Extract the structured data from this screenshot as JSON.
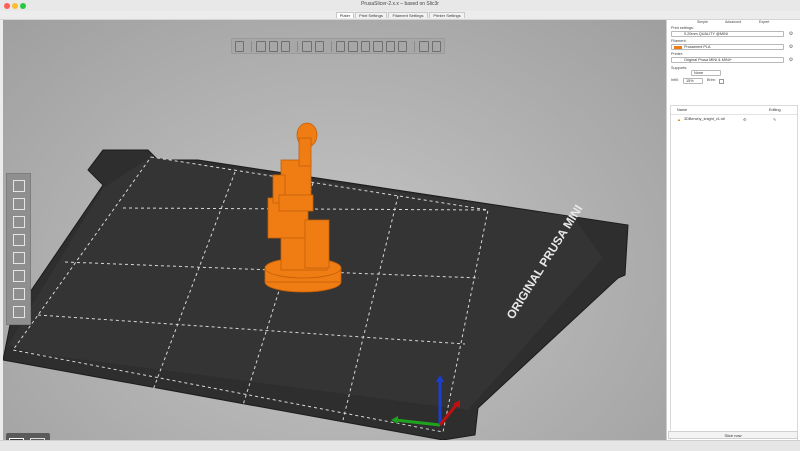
{
  "window": {
    "title": "PrusaSlicer-2.x.x – based on Slic3r",
    "traffic_colors": [
      "#ff5f57",
      "#febc2e",
      "#28c840"
    ]
  },
  "tabs": [
    {
      "label": "Plater",
      "active": true
    },
    {
      "label": "Print Settings",
      "active": false
    },
    {
      "label": "Filament Settings",
      "active": false
    },
    {
      "label": "Printer Settings",
      "active": false
    }
  ],
  "sidebar": {
    "modes": [
      "Simple",
      "Advanced",
      "Expert"
    ],
    "print_settings_label": "Print settings:",
    "print_settings_value": "0.20mm QUALITY @MINI",
    "filament_label": "Filament:",
    "filament_value": "Prusament PLA",
    "filament_color": "#f07d14",
    "printer_label": "Printer:",
    "printer_value": "Original Prusa MINI & MINI+",
    "supports_label": "Supports:",
    "supports_value": "None",
    "infill_label": "Infill:",
    "infill_value": "15%",
    "brim_label": "Brim:",
    "list_header_name": "Name",
    "list_header_editing": "Editing",
    "object_name": "3DBenchy_knight_v1.stl",
    "export_label": "Slice now"
  },
  "bed": {
    "label": "ORIGINAL PRUSA MINI",
    "model_color": "#f07d14"
  },
  "status": {
    "text": ""
  }
}
